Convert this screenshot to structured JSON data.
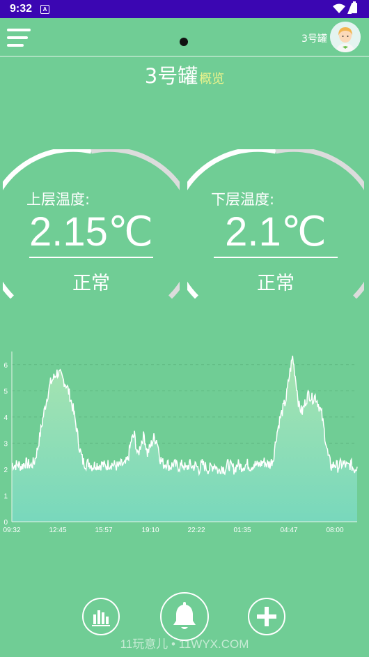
{
  "status_bar": {
    "time": "9:32",
    "notification_icon": "A"
  },
  "header": {
    "tank_name": "3号罐",
    "title": "3号罐",
    "title_suffix": "概览"
  },
  "gauges": [
    {
      "label": "上层温度:",
      "value": "2.15℃",
      "status": "正常"
    },
    {
      "label": "下层温度:",
      "value": "2.1℃",
      "status": "正常"
    }
  ],
  "chart_data": {
    "type": "area",
    "x_tick_labels": [
      "09:32",
      "12:45",
      "15:57",
      "19:10",
      "22:22",
      "01:35",
      "04:47",
      "08:00"
    ],
    "ylim": [
      0,
      6.5
    ],
    "y_ticks": [
      0,
      1,
      2,
      3,
      4,
      5,
      6
    ],
    "grid": "dashed-horizontal",
    "colors": {
      "line": "#ffffff",
      "fill_top": "#a8e4b0",
      "fill_bottom": "#78d8bc"
    },
    "series": [
      {
        "values": [
          2.2,
          2.15,
          2.2,
          2.1,
          2.25,
          2.2,
          2.15,
          2.3,
          2.8,
          3.5,
          4.2,
          4.8,
          5.3,
          5.5,
          5.7,
          5.6,
          5.4,
          5.2,
          4.8,
          4.3,
          3.6,
          2.8,
          2.3,
          2.2,
          2.25,
          2.1,
          2.2,
          2.15,
          2.2,
          2.1,
          2.2,
          2.2,
          2.15,
          2.1,
          2.2,
          2.15,
          2.4,
          3.1,
          3.3,
          2.5,
          3.0,
          3.3,
          2.6,
          2.9,
          3.2,
          3.1,
          2.4,
          2.2,
          2.25,
          2.1,
          2.2,
          2.15,
          2.1,
          2.2,
          2.0,
          2.2,
          2.1,
          2.15,
          2.0,
          2.2,
          2.1,
          2.0,
          2.1,
          2.2,
          1.9,
          2.1,
          2.0,
          2.2,
          2.1,
          2.0,
          2.2,
          2.1,
          2.15,
          2.2,
          2.1,
          2.2,
          2.15,
          2.2,
          2.3,
          2.2,
          2.2,
          2.4,
          3.3,
          3.9,
          4.3,
          4.7,
          5.6,
          6.3,
          5.4,
          4.4,
          4.2,
          4.6,
          4.9,
          4.7,
          4.8,
          4.5,
          4.1,
          3.3,
          2.5,
          2.1,
          2.2,
          2.1,
          2.2,
          2.2,
          2.1,
          2.2,
          2.0,
          2.1
        ]
      }
    ]
  },
  "bottom_nav": {
    "icons": [
      "bar-chart-icon",
      "bell-icon",
      "plus-icon"
    ]
  },
  "watermark": "11玩意儿 • 11WYX.COM"
}
